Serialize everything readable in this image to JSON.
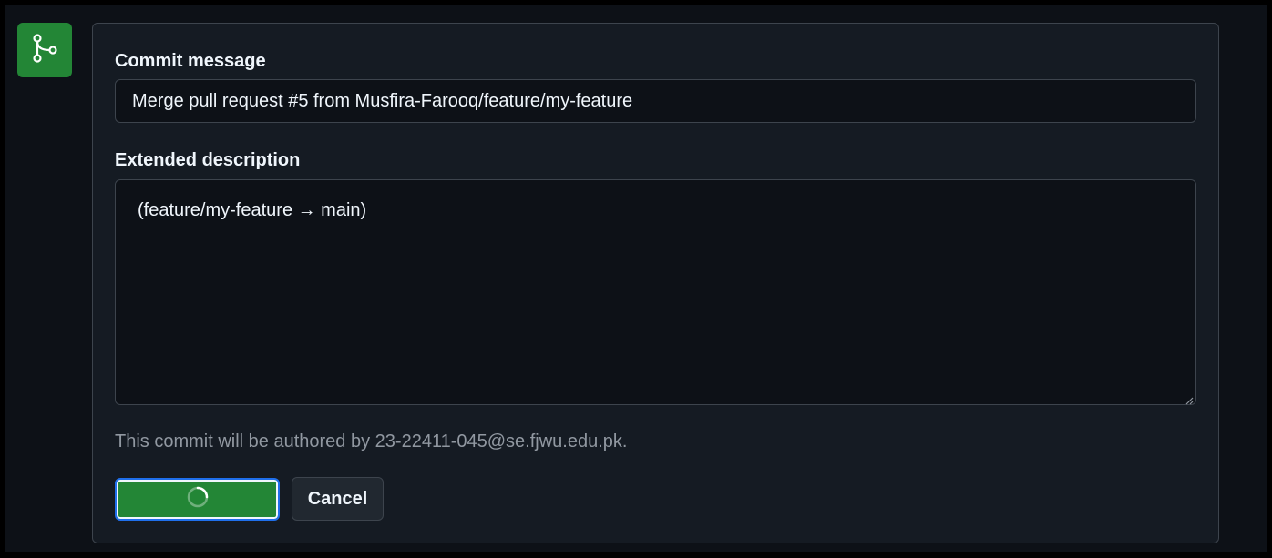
{
  "merge_dialog": {
    "icon": "git-merge-icon",
    "commit_message_label": "Commit message",
    "commit_message_value": "Merge pull request #5 from Musfira-Farooq/feature/my-feature",
    "extended_description_label": "Extended description",
    "extended_description_value": "(feature/my-feature → main)",
    "author_note": "This commit will be authored by 23-22411-045@se.fjwu.edu.pk.",
    "confirm_button_state": "loading",
    "confirm_button_icon": "spinner-icon",
    "cancel_label": "Cancel"
  },
  "colors": {
    "accent_green": "#238636",
    "focus_ring": "#1f6feb",
    "background": "#0d1117",
    "panel": "#151b23",
    "border": "#3d444d",
    "muted_text": "#9198a1"
  }
}
